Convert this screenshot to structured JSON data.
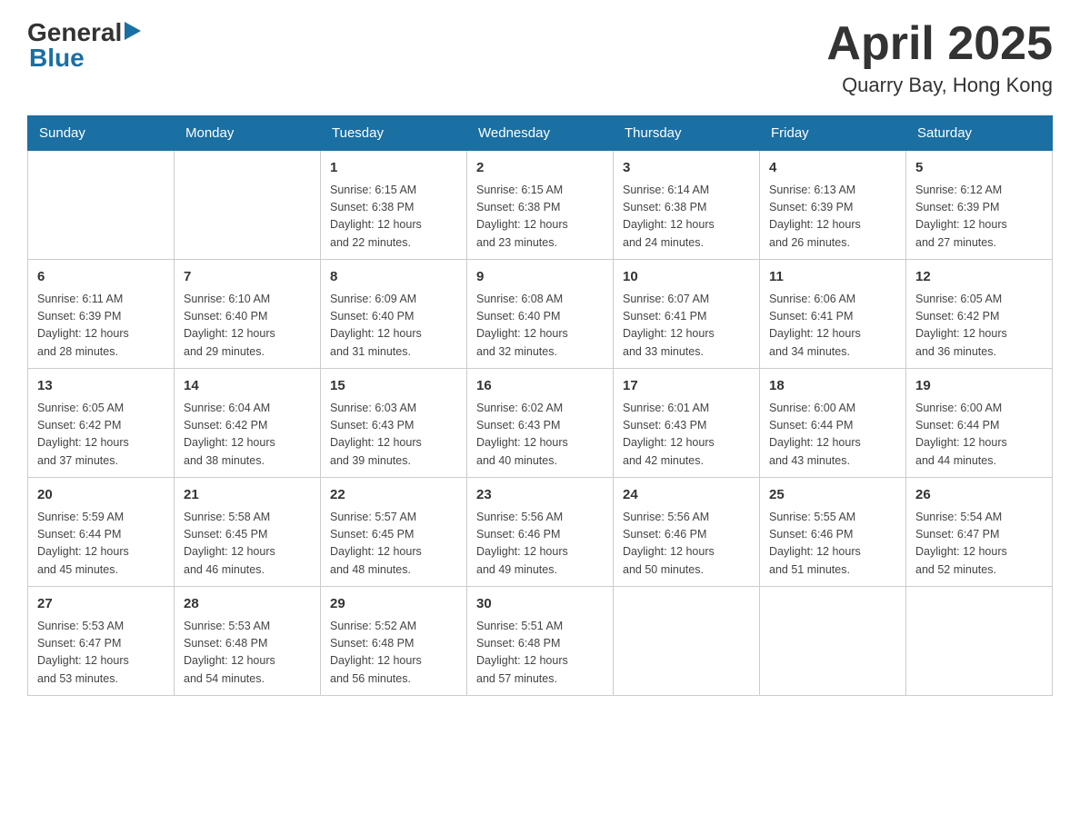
{
  "header": {
    "logo_general": "General",
    "logo_blue": "Blue",
    "title": "April 2025",
    "subtitle": "Quarry Bay, Hong Kong"
  },
  "weekdays": [
    "Sunday",
    "Monday",
    "Tuesday",
    "Wednesday",
    "Thursday",
    "Friday",
    "Saturday"
  ],
  "weeks": [
    [
      {
        "day": "",
        "info": ""
      },
      {
        "day": "",
        "info": ""
      },
      {
        "day": "1",
        "info": "Sunrise: 6:15 AM\nSunset: 6:38 PM\nDaylight: 12 hours\nand 22 minutes."
      },
      {
        "day": "2",
        "info": "Sunrise: 6:15 AM\nSunset: 6:38 PM\nDaylight: 12 hours\nand 23 minutes."
      },
      {
        "day": "3",
        "info": "Sunrise: 6:14 AM\nSunset: 6:38 PM\nDaylight: 12 hours\nand 24 minutes."
      },
      {
        "day": "4",
        "info": "Sunrise: 6:13 AM\nSunset: 6:39 PM\nDaylight: 12 hours\nand 26 minutes."
      },
      {
        "day": "5",
        "info": "Sunrise: 6:12 AM\nSunset: 6:39 PM\nDaylight: 12 hours\nand 27 minutes."
      }
    ],
    [
      {
        "day": "6",
        "info": "Sunrise: 6:11 AM\nSunset: 6:39 PM\nDaylight: 12 hours\nand 28 minutes."
      },
      {
        "day": "7",
        "info": "Sunrise: 6:10 AM\nSunset: 6:40 PM\nDaylight: 12 hours\nand 29 minutes."
      },
      {
        "day": "8",
        "info": "Sunrise: 6:09 AM\nSunset: 6:40 PM\nDaylight: 12 hours\nand 31 minutes."
      },
      {
        "day": "9",
        "info": "Sunrise: 6:08 AM\nSunset: 6:40 PM\nDaylight: 12 hours\nand 32 minutes."
      },
      {
        "day": "10",
        "info": "Sunrise: 6:07 AM\nSunset: 6:41 PM\nDaylight: 12 hours\nand 33 minutes."
      },
      {
        "day": "11",
        "info": "Sunrise: 6:06 AM\nSunset: 6:41 PM\nDaylight: 12 hours\nand 34 minutes."
      },
      {
        "day": "12",
        "info": "Sunrise: 6:05 AM\nSunset: 6:42 PM\nDaylight: 12 hours\nand 36 minutes."
      }
    ],
    [
      {
        "day": "13",
        "info": "Sunrise: 6:05 AM\nSunset: 6:42 PM\nDaylight: 12 hours\nand 37 minutes."
      },
      {
        "day": "14",
        "info": "Sunrise: 6:04 AM\nSunset: 6:42 PM\nDaylight: 12 hours\nand 38 minutes."
      },
      {
        "day": "15",
        "info": "Sunrise: 6:03 AM\nSunset: 6:43 PM\nDaylight: 12 hours\nand 39 minutes."
      },
      {
        "day": "16",
        "info": "Sunrise: 6:02 AM\nSunset: 6:43 PM\nDaylight: 12 hours\nand 40 minutes."
      },
      {
        "day": "17",
        "info": "Sunrise: 6:01 AM\nSunset: 6:43 PM\nDaylight: 12 hours\nand 42 minutes."
      },
      {
        "day": "18",
        "info": "Sunrise: 6:00 AM\nSunset: 6:44 PM\nDaylight: 12 hours\nand 43 minutes."
      },
      {
        "day": "19",
        "info": "Sunrise: 6:00 AM\nSunset: 6:44 PM\nDaylight: 12 hours\nand 44 minutes."
      }
    ],
    [
      {
        "day": "20",
        "info": "Sunrise: 5:59 AM\nSunset: 6:44 PM\nDaylight: 12 hours\nand 45 minutes."
      },
      {
        "day": "21",
        "info": "Sunrise: 5:58 AM\nSunset: 6:45 PM\nDaylight: 12 hours\nand 46 minutes."
      },
      {
        "day": "22",
        "info": "Sunrise: 5:57 AM\nSunset: 6:45 PM\nDaylight: 12 hours\nand 48 minutes."
      },
      {
        "day": "23",
        "info": "Sunrise: 5:56 AM\nSunset: 6:46 PM\nDaylight: 12 hours\nand 49 minutes."
      },
      {
        "day": "24",
        "info": "Sunrise: 5:56 AM\nSunset: 6:46 PM\nDaylight: 12 hours\nand 50 minutes."
      },
      {
        "day": "25",
        "info": "Sunrise: 5:55 AM\nSunset: 6:46 PM\nDaylight: 12 hours\nand 51 minutes."
      },
      {
        "day": "26",
        "info": "Sunrise: 5:54 AM\nSunset: 6:47 PM\nDaylight: 12 hours\nand 52 minutes."
      }
    ],
    [
      {
        "day": "27",
        "info": "Sunrise: 5:53 AM\nSunset: 6:47 PM\nDaylight: 12 hours\nand 53 minutes."
      },
      {
        "day": "28",
        "info": "Sunrise: 5:53 AM\nSunset: 6:48 PM\nDaylight: 12 hours\nand 54 minutes."
      },
      {
        "day": "29",
        "info": "Sunrise: 5:52 AM\nSunset: 6:48 PM\nDaylight: 12 hours\nand 56 minutes."
      },
      {
        "day": "30",
        "info": "Sunrise: 5:51 AM\nSunset: 6:48 PM\nDaylight: 12 hours\nand 57 minutes."
      },
      {
        "day": "",
        "info": ""
      },
      {
        "day": "",
        "info": ""
      },
      {
        "day": "",
        "info": ""
      }
    ]
  ]
}
